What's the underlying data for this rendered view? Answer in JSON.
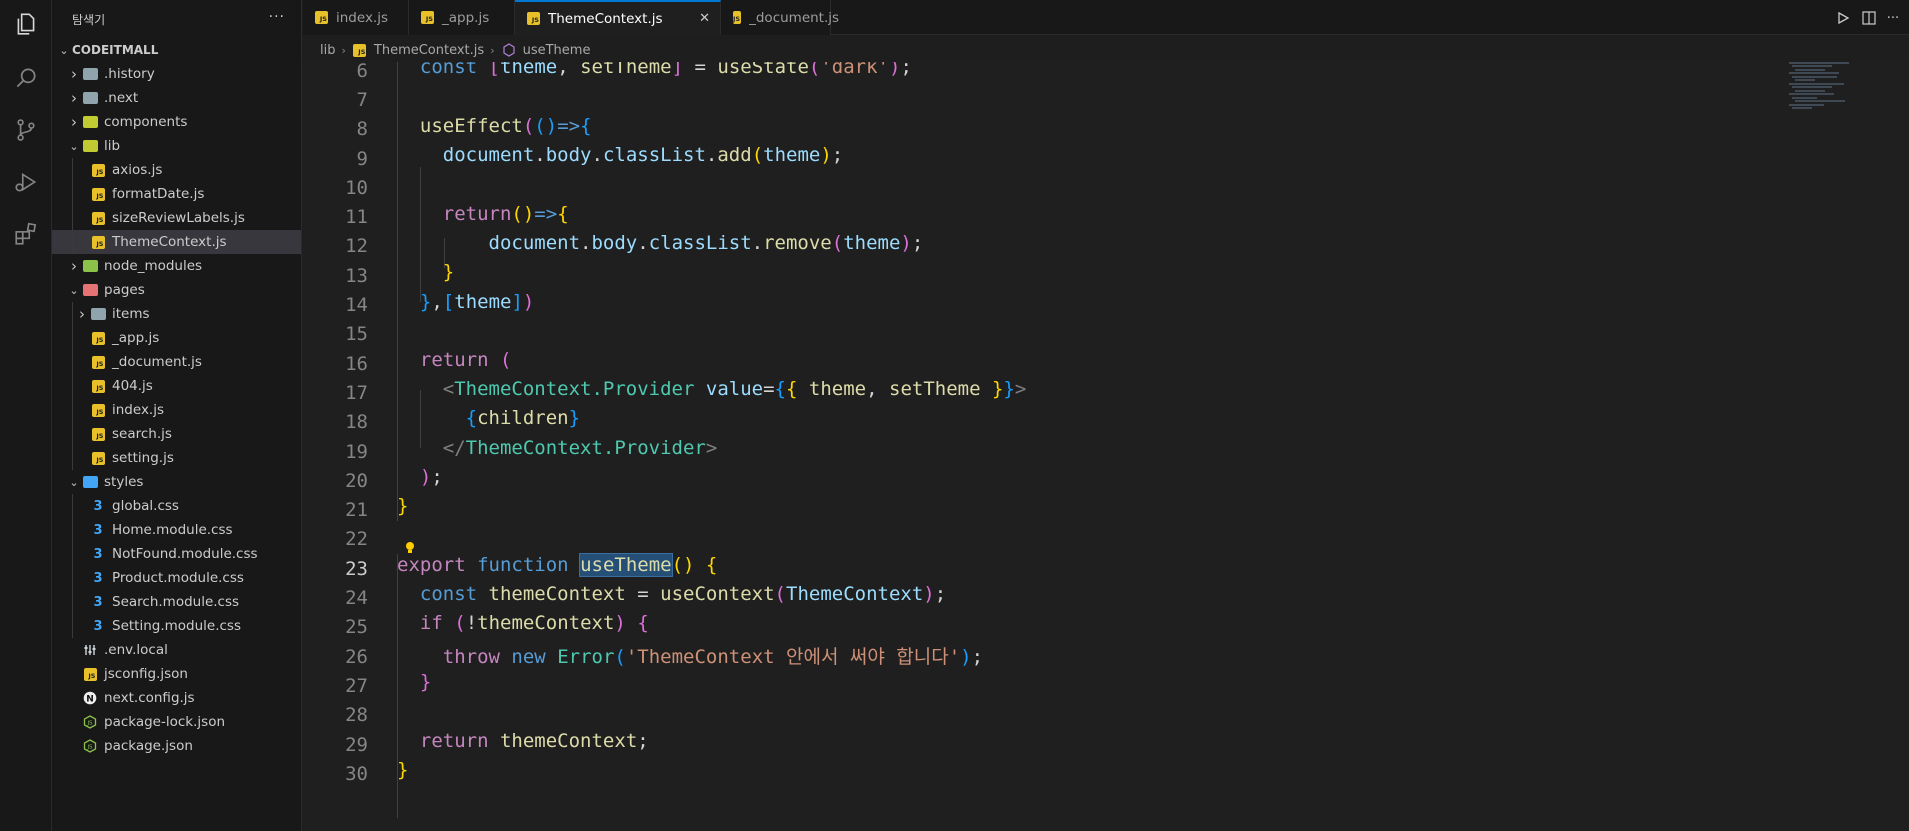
{
  "sidebar": {
    "title": "탐색기",
    "more": "···",
    "root": "CODEITMALL",
    "items": [
      {
        "label": ".history",
        "type": "folder",
        "depth": 1,
        "expanded": false
      },
      {
        "label": ".next",
        "type": "folder",
        "depth": 1,
        "expanded": false
      },
      {
        "label": "components",
        "type": "folder",
        "depth": 1,
        "expanded": false
      },
      {
        "label": "lib",
        "type": "folder",
        "depth": 1,
        "expanded": true
      },
      {
        "label": "axios.js",
        "type": "js",
        "depth": 2
      },
      {
        "label": "formatDate.js",
        "type": "js",
        "depth": 2
      },
      {
        "label": "sizeReviewLabels.js",
        "type": "js",
        "depth": 2
      },
      {
        "label": "ThemeContext.js",
        "type": "js",
        "depth": 2,
        "active": true
      },
      {
        "label": "node_modules",
        "type": "folder",
        "depth": 1,
        "expanded": false
      },
      {
        "label": "pages",
        "type": "folder",
        "depth": 1,
        "expanded": true
      },
      {
        "label": "items",
        "type": "folder",
        "depth": 2,
        "expanded": false
      },
      {
        "label": "_app.js",
        "type": "js",
        "depth": 2
      },
      {
        "label": "_document.js",
        "type": "js",
        "depth": 2
      },
      {
        "label": "404.js",
        "type": "js",
        "depth": 2
      },
      {
        "label": "index.js",
        "type": "js",
        "depth": 2
      },
      {
        "label": "search.js",
        "type": "js",
        "depth": 2
      },
      {
        "label": "setting.js",
        "type": "js",
        "depth": 2
      },
      {
        "label": "styles",
        "type": "folder",
        "depth": 1,
        "expanded": true
      },
      {
        "label": "global.css",
        "type": "css",
        "depth": 2
      },
      {
        "label": "Home.module.css",
        "type": "css",
        "depth": 2
      },
      {
        "label": "NotFound.module.css",
        "type": "css",
        "depth": 2
      },
      {
        "label": "Product.module.css",
        "type": "css",
        "depth": 2
      },
      {
        "label": "Search.module.css",
        "type": "css",
        "depth": 2
      },
      {
        "label": "Setting.module.css",
        "type": "css",
        "depth": 2
      },
      {
        "label": ".env.local",
        "type": "env",
        "depth": 1
      },
      {
        "label": "jsconfig.json",
        "type": "json",
        "depth": 1
      },
      {
        "label": "next.config.js",
        "type": "next",
        "depth": 1
      },
      {
        "label": "package-lock.json",
        "type": "node",
        "depth": 1
      },
      {
        "label": "package.json",
        "type": "node",
        "depth": 1
      }
    ]
  },
  "tabs": [
    {
      "label": "index.js",
      "active": false
    },
    {
      "label": "_app.js",
      "active": false
    },
    {
      "label": "ThemeContext.js",
      "active": true
    },
    {
      "label": "_document.js",
      "active": false
    }
  ],
  "tab_close": "✕",
  "breadcrumb": {
    "folder": "lib",
    "file": "ThemeContext.js",
    "symbol": "useTheme"
  },
  "editor": {
    "line_numbers": [
      "6",
      "7",
      "8",
      "9",
      "10",
      "11",
      "12",
      "13",
      "14",
      "15",
      "16",
      "17",
      "18",
      "19",
      "20",
      "21",
      "22",
      "23",
      "24",
      "25",
      "26",
      "27",
      "28",
      "29",
      "30"
    ],
    "current_line": "23",
    "code": {
      "l6_const": "const",
      "l6_theme": "theme",
      "l6_settheme": "setTheme",
      "l6_usestate": "useState",
      "l6_str": "'dark'",
      "l8_useeffect": "useEffect",
      "l9_document": "document",
      "l9_body": "body",
      "l9_classlist": "classList",
      "l9_add": "add",
      "l9_theme": "theme",
      "l11_return": "return",
      "l12_document": "document",
      "l12_body": "body",
      "l12_classlist": "classList",
      "l12_remove": "remove",
      "l12_theme": "theme",
      "l14_theme": "theme",
      "l16_return": "return",
      "l17_provider": "ThemeContext.Provider",
      "l17_value": "value",
      "l17_theme": "theme",
      "l17_settheme": "setTheme",
      "l18_children": "children",
      "l19_provider": "ThemeContext.Provider",
      "l23_export": "export",
      "l23_function": "function",
      "l23_name": "useTheme",
      "l24_const": "const",
      "l24_var": "themeContext",
      "l24_usecontext": "useContext",
      "l24_arg": "ThemeContext",
      "l25_if": "if",
      "l25_var": "themeContext",
      "l26_throw": "throw",
      "l26_new": "new",
      "l26_error": "Error",
      "l26_str": "'ThemeContext 안에서 써야 합니다'",
      "l29_return": "return",
      "l29_var": "themeContext"
    }
  },
  "colors": {
    "accent": "#0078d4",
    "js_badge": "#e8c12a",
    "css_icon": "#42a5f5",
    "selection": "#264f78"
  }
}
